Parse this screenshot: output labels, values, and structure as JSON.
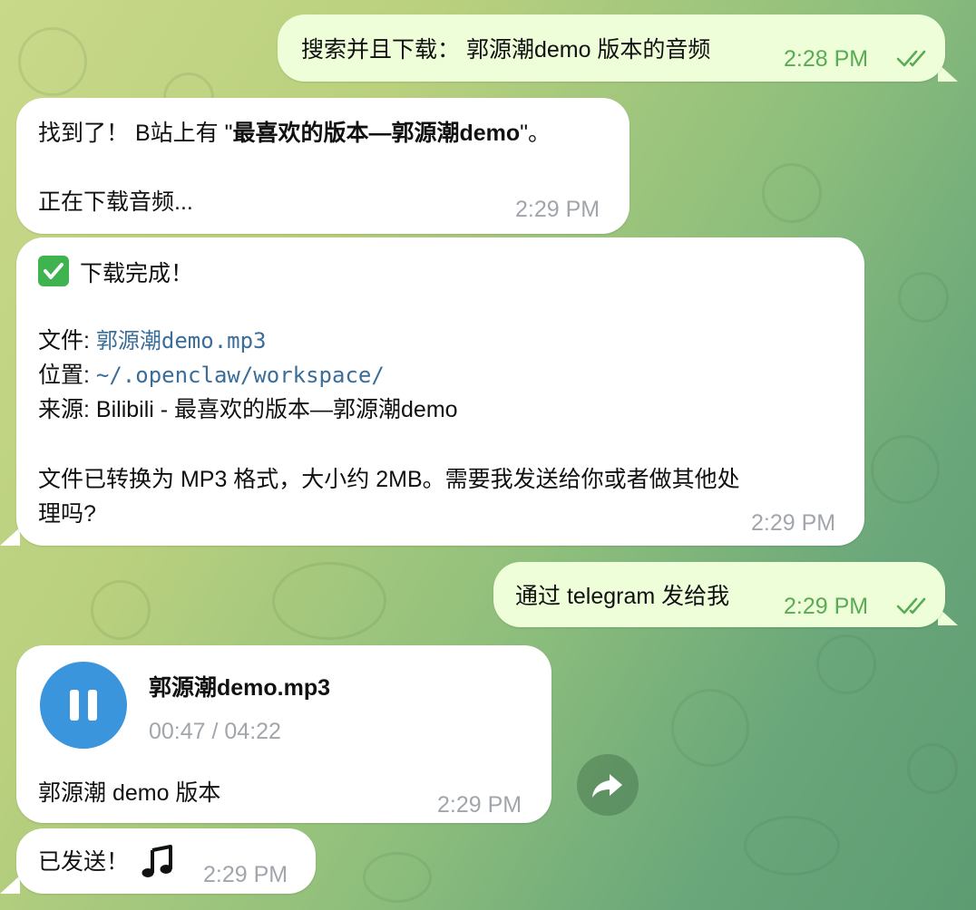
{
  "colors": {
    "outgoing_bubble": "#eefed8",
    "incoming_bubble": "#ffffff",
    "link": "#3a6d99",
    "play_button": "#3b95dd",
    "outgoing_time": "#5aab55",
    "incoming_time": "#a1a6ac"
  },
  "messages": [
    {
      "direction": "outgoing",
      "text": "搜索并且下载： 郭源潮demo 版本的音频",
      "time": "2:28 PM",
      "status_icon": "double-check-icon"
    },
    {
      "direction": "incoming",
      "line1_prefix": "找到了！ B站上有 \"",
      "line1_bold": "最喜欢的版本—郭源潮demo",
      "line1_suffix": "\"。",
      "line2": "正在下载音频...",
      "time": "2:29 PM"
    },
    {
      "direction": "incoming",
      "emoji_icon": "check-mark-button-icon",
      "heading": "下载完成！",
      "file_label": "文件: ",
      "file_value": "郭源潮demo.mp3",
      "location_label": "位置: ",
      "location_value": "~/.openclaw/workspace/",
      "source_label": "来源: ",
      "source_value": "Bilibili - 最喜欢的版本—郭源潮demo",
      "body_line1": "文件已转换为 MP3 格式，大小约 2MB。需要我发送给你或者做其他处",
      "body_line2": "理吗?",
      "time": "2:29 PM"
    },
    {
      "direction": "outgoing",
      "text": "通过 telegram 发给我",
      "time": "2:29 PM",
      "status_icon": "double-check-icon"
    },
    {
      "direction": "incoming",
      "audio_title": "郭源潮demo.mp3",
      "audio_progress": "00:47 / 04:22",
      "caption": "郭源潮 demo 版本",
      "time": "2:29 PM",
      "play_state_icon": "pause-icon"
    },
    {
      "direction": "incoming",
      "text": "已发送！",
      "emoji_icon": "musical-note-icon",
      "time": "2:29 PM"
    }
  ],
  "forward_icon": "forward-arrow-icon"
}
